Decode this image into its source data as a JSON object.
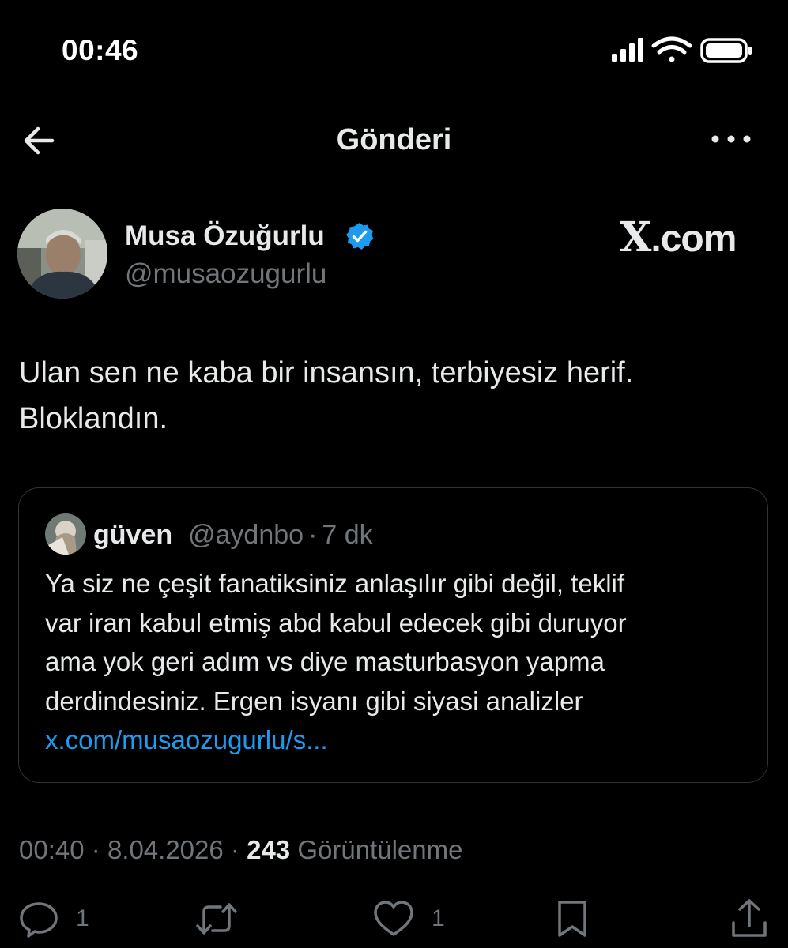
{
  "status_bar": {
    "time": "00:46"
  },
  "header": {
    "title": "Gönderi"
  },
  "author": {
    "name": "Musa Özuğurlu",
    "handle": "@musaozugurlu"
  },
  "watermark": {
    "prefix": "X",
    "suffix": ".com"
  },
  "tweet": {
    "text": "Ulan sen ne kaba bir insansın, terbiyesiz herif.\nBloklandın."
  },
  "quote": {
    "name": "güven",
    "handle": "@aydnbo",
    "separator": "·",
    "time": "7 dk",
    "text": "Ya siz ne çeşit fanatiksiniz anlaşılır gibi değil, teklif\nvar iran kabul etmiş abd kabul edecek gibi duruyor\nama yok geri adım vs diye masturbasyon yapma\nderdindesiniz. Ergen isyanı gibi siyasi analizler",
    "link": "x.com/musaozugurlu/s..."
  },
  "meta": {
    "time": "00:40",
    "separator": "·",
    "date": "8.04.2026",
    "views_count": "243",
    "views_label": "Görüntülenme"
  },
  "actions": {
    "reply_count": "1",
    "like_count": "1"
  },
  "icons": {
    "back": "arrow-left-icon",
    "more": "more-horizontal-icon",
    "verified": "verified-badge-icon",
    "reply": "reply-icon",
    "retweet": "retweet-icon",
    "like": "heart-icon",
    "bookmark": "bookmark-icon",
    "share": "share-icon"
  },
  "colors": {
    "background": "#000000",
    "text": "#e7e9ea",
    "secondary": "#71767b",
    "accent": "#1d9bf0",
    "border": "#2f3336"
  }
}
